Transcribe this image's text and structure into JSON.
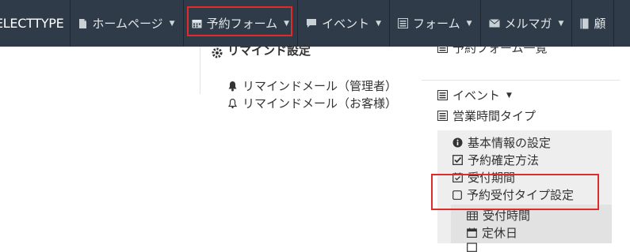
{
  "navbar": {
    "brand": "ELECTTYPE",
    "items": [
      {
        "label": "ホームページ",
        "icon": "file-icon"
      },
      {
        "label": "予約フォーム",
        "icon": "calendar-icon",
        "highlighted": true
      },
      {
        "label": "イベント",
        "icon": "comment-icon"
      },
      {
        "label": "フォーム",
        "icon": "list-alt-icon"
      },
      {
        "label": "メルマガ",
        "icon": "envelope-icon"
      },
      {
        "label": "顧",
        "icon": "book-icon"
      }
    ]
  },
  "left_menu": {
    "header": "リマインド設定",
    "items": [
      {
        "label": "リマインドメール（管理者）",
        "icon": "bell-filled-icon"
      },
      {
        "label": "リマインドメール（お客様）",
        "icon": "bell-outline-icon"
      }
    ]
  },
  "right_menu": {
    "top_partial": "予約フォーム一覧",
    "event": {
      "label": "イベント",
      "icon": "list-alt-icon"
    },
    "hours": {
      "label": "営業時間タイプ",
      "icon": "list-alt-icon"
    },
    "sub_items": [
      {
        "label": "基本情報の設定",
        "icon": "info-circle-icon"
      },
      {
        "label": "予約確定方法",
        "icon": "check-square-icon"
      },
      {
        "label": "受付期間",
        "icon": "calendar-check-icon"
      },
      {
        "label": "予約受付タイプ設定",
        "icon": "square-outline-icon"
      }
    ],
    "sub_sub_items": [
      {
        "label": "受付時間",
        "icon": "calendar-grid-icon"
      },
      {
        "label": "定休日",
        "icon": "calendar-icon"
      },
      {
        "label": "",
        "icon": "calendar-icon"
      }
    ]
  },
  "colors": {
    "navbar_bg": "#2f3b48",
    "highlight": "#e12a2a",
    "panel_grey": "#eeeeee"
  }
}
